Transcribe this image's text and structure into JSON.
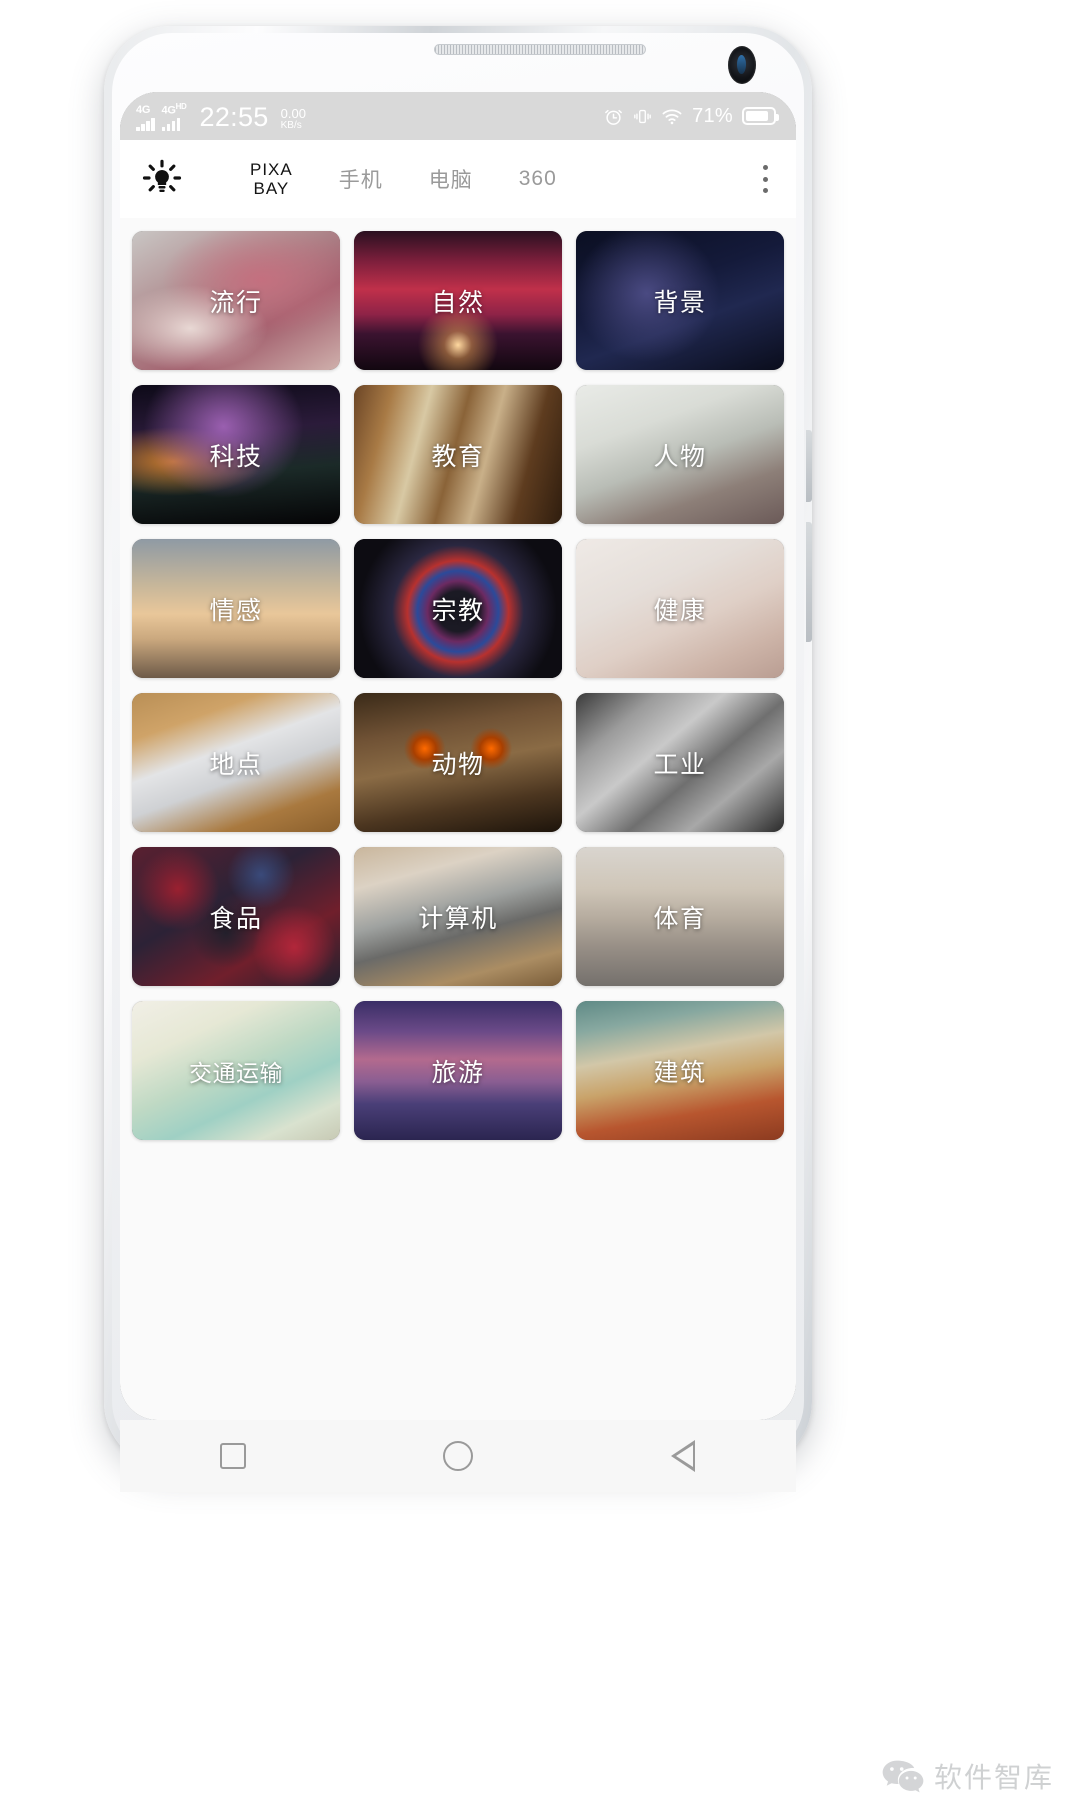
{
  "status_bar": {
    "network_1": "4G",
    "network_2": "4G",
    "network_2_sup": "HD",
    "clock": "22:55",
    "net_speed_value": "0.00",
    "net_speed_unit": "KB/s",
    "battery_percent": "71%",
    "icons": [
      "alarm-clock-icon",
      "vibrate-icon",
      "wifi-icon",
      "battery-icon"
    ]
  },
  "toolbar": {
    "logo_line1": "PIXA",
    "logo_line2": "BAY",
    "bulb_icon": "lightbulb-icon",
    "menu_icon": "overflow-menu-icon",
    "tabs": [
      {
        "label": "手机",
        "active": false
      },
      {
        "label": "电脑",
        "active": false
      },
      {
        "label": "360",
        "active": false
      }
    ]
  },
  "grid": {
    "cards": [
      {
        "label": "流行",
        "art": "art-liuxing"
      },
      {
        "label": "自然",
        "art": "art-ziran"
      },
      {
        "label": "背景",
        "art": "art-beijing"
      },
      {
        "label": "科技",
        "art": "art-keji"
      },
      {
        "label": "教育",
        "art": "art-jiaoyu"
      },
      {
        "label": "人物",
        "art": "art-renwu"
      },
      {
        "label": "情感",
        "art": "art-qinggan"
      },
      {
        "label": "宗教",
        "art": "art-zongjiao"
      },
      {
        "label": "健康",
        "art": "art-jiankang"
      },
      {
        "label": "地点",
        "art": "art-didian"
      },
      {
        "label": "动物",
        "art": "art-dongwu"
      },
      {
        "label": "工业",
        "art": "art-gongye"
      },
      {
        "label": "食品",
        "art": "art-shipin"
      },
      {
        "label": "计算机",
        "art": "art-jisuanji"
      },
      {
        "label": "体育",
        "art": "art-tiyu"
      },
      {
        "label": "交通运输",
        "art": "art-jiaotong"
      },
      {
        "label": "旅游",
        "art": "art-lvyou"
      },
      {
        "label": "建筑",
        "art": "art-jianzhu"
      }
    ]
  },
  "system_nav": {
    "recents_icon": "square-recents-icon",
    "home_icon": "circle-home-icon",
    "back_icon": "triangle-back-icon"
  },
  "watermark": {
    "icon": "wechat-icon",
    "text": "软件智库"
  },
  "colors": {
    "status_bar_bg": "#d9d9d9",
    "toolbar_bg": "#ffffff",
    "page_bg": "#fafafa",
    "tab_inactive": "#9a9a9a",
    "brand_text": "#141414"
  }
}
